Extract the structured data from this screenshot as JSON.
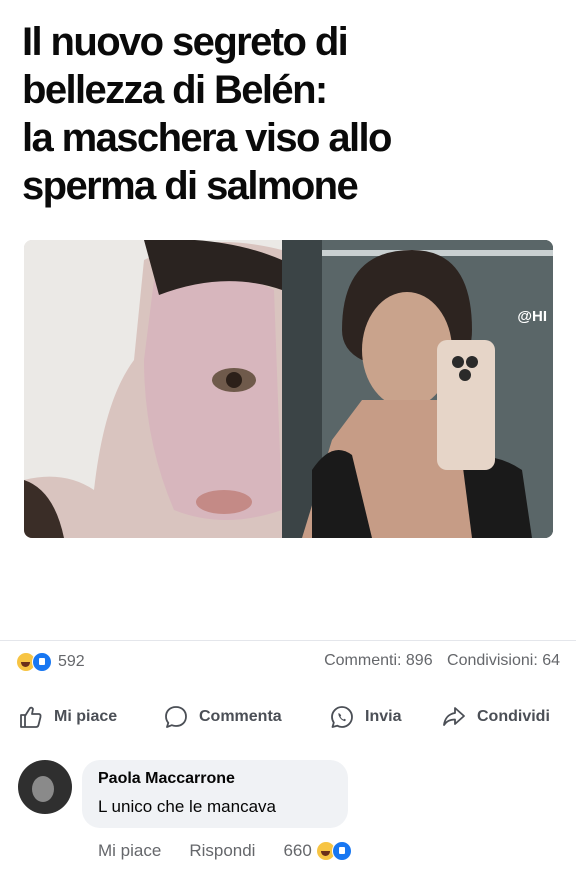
{
  "article": {
    "headline_lines": [
      "Il nuovo segreto di",
      "bellezza di Belén:",
      "la maschera viso allo",
      "sperma di salmone"
    ],
    "image_watermark": "@HI"
  },
  "stats": {
    "reaction_count": "592",
    "comments": "Commenti: 896",
    "shares": "Condivisioni: 64"
  },
  "actions": {
    "like": "Mi piace",
    "comment": "Commenta",
    "send": "Invia",
    "share": "Condividi"
  },
  "comment": {
    "author": "Paola Maccarrone",
    "text": "L unico che le mancava",
    "like_label": "Mi piace",
    "reply_label": "Rispondi",
    "reaction_count": "660"
  },
  "colors": {
    "muted_text": "#65676b",
    "like_blue": "#1877f2",
    "bubble_bg": "#f0f2f5",
    "haha_yellow": "#f7c443"
  }
}
